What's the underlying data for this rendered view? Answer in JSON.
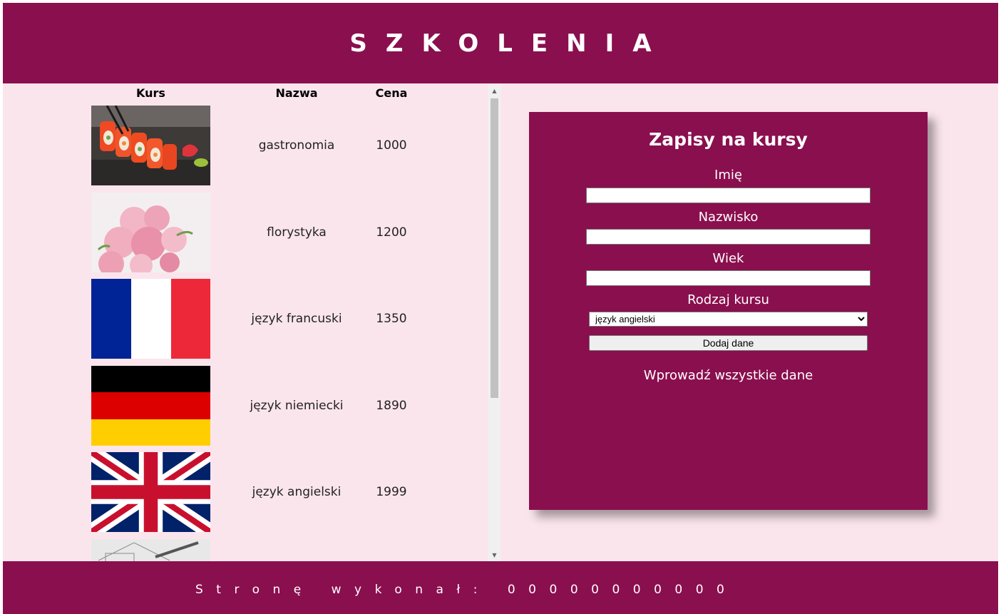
{
  "header": {
    "title": "SZKOLENIA"
  },
  "table": {
    "headers": {
      "kurs": "Kurs",
      "nazwa": "Nazwa",
      "cena": "Cena"
    },
    "rows": [
      {
        "name": "gastronomia",
        "price": "1000",
        "image": "sushi-image"
      },
      {
        "name": "florystyka",
        "price": "1200",
        "image": "flowers-image"
      },
      {
        "name": "język francuski",
        "price": "1350",
        "image": "french-flag"
      },
      {
        "name": "język niemiecki",
        "price": "1890",
        "image": "german-flag"
      },
      {
        "name": "język angielski",
        "price": "1999",
        "image": "uk-flag"
      }
    ]
  },
  "form": {
    "title": "Zapisy na kursy",
    "labels": {
      "imie": "Imię",
      "nazwisko": "Nazwisko",
      "wiek": "Wiek",
      "rodzaj": "Rodzaj kursu"
    },
    "values": {
      "imie": "",
      "nazwisko": "",
      "wiek": ""
    },
    "select_value": "język angielski",
    "button_label": "Dodaj dane",
    "message": "Wprowadź wszystkie dane"
  },
  "footer": {
    "text": "Stronę wykonał: 00000000000"
  },
  "colors": {
    "accent": "#8a0f4e",
    "background": "#fbe5ed"
  }
}
